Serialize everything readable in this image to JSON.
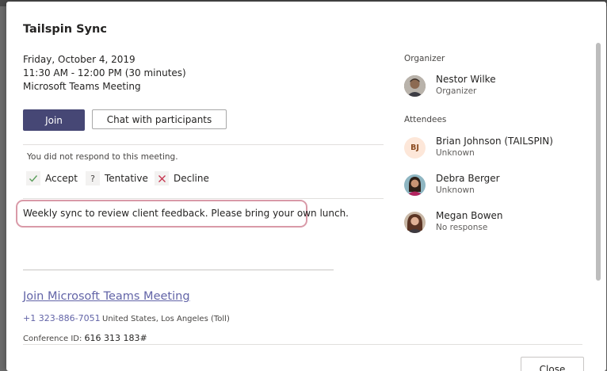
{
  "meeting": {
    "title": "Tailspin Sync",
    "date": "Friday, October 4, 2019",
    "time": "11:30 AM - 12:00 PM (30 minutes)",
    "type": "Microsoft Teams Meeting"
  },
  "actions": {
    "join_label": "Join",
    "chat_label": "Chat with participants"
  },
  "rsvp": {
    "status_text": "You did not respond to this meeting.",
    "accept_label": "Accept",
    "tentative_label": "Tentative",
    "decline_label": "Decline"
  },
  "description": "Weekly sync to review client feedback. Please bring your own lunch.",
  "teams_info": {
    "join_link": "Join Microsoft Teams Meeting",
    "phone": "+1 323-886-7051",
    "phone_location": "United States, Los Angeles (Toll)",
    "conference_label": "Conference ID:",
    "conference_id": "616 313 183#"
  },
  "organizer": {
    "section_label": "Organizer",
    "name": "Nestor Wilke",
    "role": "Organizer"
  },
  "attendees": {
    "section_label": "Attendees",
    "list": [
      {
        "name": "Brian Johnson (TAILSPIN)",
        "status": "Unknown",
        "initials": "BJ"
      },
      {
        "name": "Debra Berger",
        "status": "Unknown"
      },
      {
        "name": "Megan Bowen",
        "status": "No response"
      }
    ]
  },
  "footer": {
    "close_label": "Close"
  },
  "colors": {
    "accent": "#464775",
    "link": "#6264a7",
    "highlight_border": "#d99aa8"
  }
}
